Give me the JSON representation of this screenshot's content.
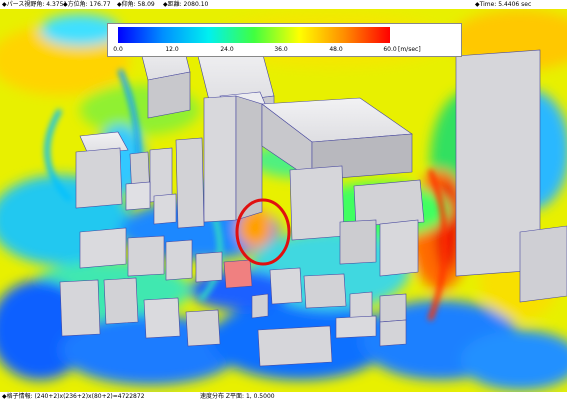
{
  "header": {
    "perspective": "◆パース視野角: 4.3751",
    "azimuth": "◆方位角: 176.77",
    "elevation": "◆仰角: 58.09",
    "distance": "◆距離: 2080.10",
    "time": "◆Time: 5.4406  sec"
  },
  "legend": {
    "ticks": [
      "0.0",
      "12.0",
      "24.0",
      "36.0",
      "48.0",
      "60.0"
    ],
    "unit": "[m/sec]",
    "gradient_colors": [
      "#0000ff",
      "#0090ff",
      "#00f0f0",
      "#40ff40",
      "#ffff00",
      "#ff8c00",
      "#ff0000"
    ]
  },
  "status": {
    "grid_info": "◆格子情報:  (240+2)x(236+2)x(80+2)=4722872",
    "velocity_plane": "速度分布  Z平面: 1,  0.5000"
  },
  "highlight": {
    "color": "#e01010",
    "shape": "ellipse"
  }
}
